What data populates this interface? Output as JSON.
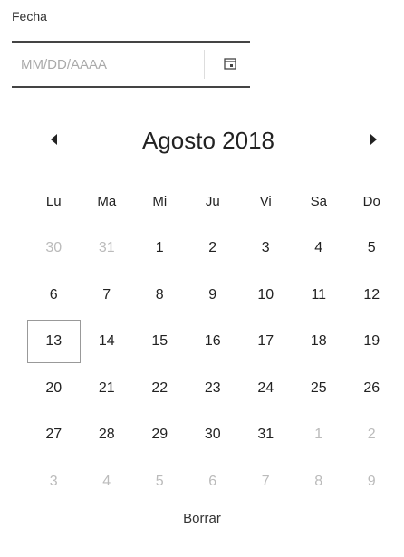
{
  "field": {
    "label": "Fecha",
    "placeholder": "MM/DD/AAAA",
    "value": ""
  },
  "calendar": {
    "month_label": "Agosto 2018",
    "weekdays": [
      "Lu",
      "Ma",
      "Mi",
      "Ju",
      "Vi",
      "Sa",
      "Do"
    ],
    "weeks": [
      [
        {
          "d": "30",
          "m": true
        },
        {
          "d": "31",
          "m": true
        },
        {
          "d": "1"
        },
        {
          "d": "2"
        },
        {
          "d": "3"
        },
        {
          "d": "4"
        },
        {
          "d": "5"
        }
      ],
      [
        {
          "d": "6"
        },
        {
          "d": "7"
        },
        {
          "d": "8"
        },
        {
          "d": "9"
        },
        {
          "d": "10"
        },
        {
          "d": "11"
        },
        {
          "d": "12"
        }
      ],
      [
        {
          "d": "13",
          "today": true
        },
        {
          "d": "14"
        },
        {
          "d": "15"
        },
        {
          "d": "16"
        },
        {
          "d": "17"
        },
        {
          "d": "18"
        },
        {
          "d": "19"
        }
      ],
      [
        {
          "d": "20"
        },
        {
          "d": "21"
        },
        {
          "d": "22"
        },
        {
          "d": "23"
        },
        {
          "d": "24"
        },
        {
          "d": "25"
        },
        {
          "d": "26"
        }
      ],
      [
        {
          "d": "27"
        },
        {
          "d": "28"
        },
        {
          "d": "29"
        },
        {
          "d": "30"
        },
        {
          "d": "31"
        },
        {
          "d": "1",
          "m": true
        },
        {
          "d": "2",
          "m": true
        }
      ],
      [
        {
          "d": "3",
          "m": true
        },
        {
          "d": "4",
          "m": true
        },
        {
          "d": "5",
          "m": true
        },
        {
          "d": "6",
          "m": true
        },
        {
          "d": "7",
          "m": true
        },
        {
          "d": "8",
          "m": true
        },
        {
          "d": "9",
          "m": true
        }
      ]
    ],
    "clear_label": "Borrar"
  },
  "icons": {
    "calendar": "calendar-icon",
    "prev": "triangle-left-icon",
    "next": "triangle-right-icon"
  },
  "colors": {
    "text": "#222222",
    "muted": "#bbbbbb",
    "today_border": "#999999"
  }
}
